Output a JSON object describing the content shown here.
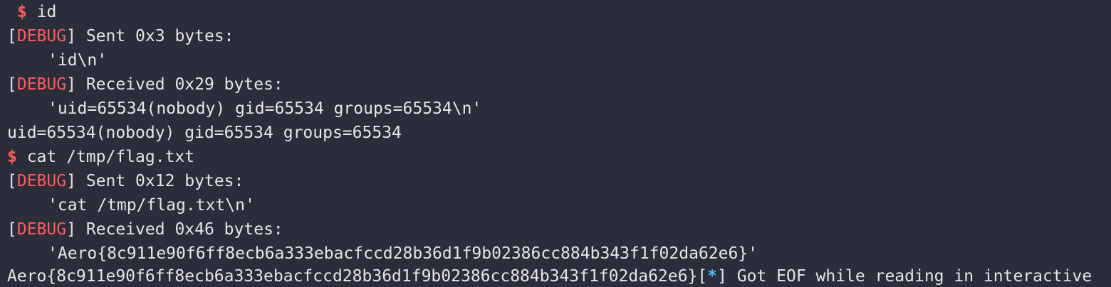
{
  "prompt_symbol": "$",
  "commands": [
    " id",
    " cat /tmp/flag.txt"
  ],
  "debug_tag": "DEBUG",
  "lines": {
    "sent1": " Sent 0x3 bytes:",
    "payload1": "'id\\n'",
    "recv1": " Received 0x29 bytes:",
    "payload2": "'uid=65534(nobody) gid=65534 groups=65534\\n'",
    "output1": "uid=65534(nobody) gid=65534 groups=65534",
    "sent2": " Sent 0x12 bytes:",
    "payload3": "'cat /tmp/flag.txt\\n'",
    "recv2": " Received 0x46 bytes:",
    "payload4": "'Aero{8c911e90f6ff8ecb6a333ebacfccd28b36d1f9b02386cc884b343f1f02da62e6}'",
    "output2": "Aero{8c911e90f6ff8ecb6a333ebacfccd28b36d1f9b02386cc884b343f1f02da62e6}",
    "info_tag": "*",
    "info_text": " Got EOF while reading in interactive"
  },
  "colors": {
    "background": "#2b2d3a",
    "text": "#e6e6e6",
    "accent_red": "#ff5c57",
    "accent_blue": "#4fb8ff"
  }
}
